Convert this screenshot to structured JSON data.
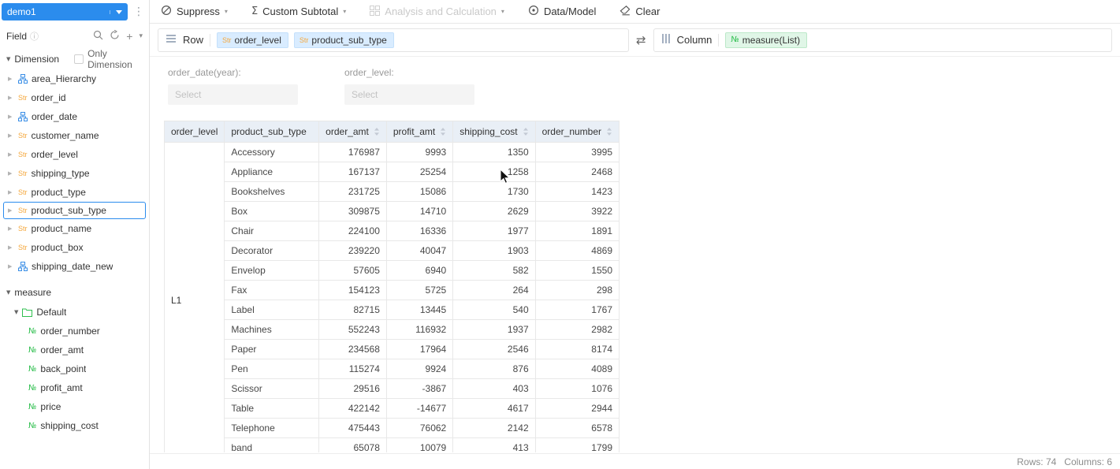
{
  "sidebar": {
    "dataset_label": "demo1",
    "field_label": "Field",
    "dimension": {
      "section_label": "Dimension",
      "only_dimension_label": "Only Dimension",
      "items": [
        {
          "label": "area_Hierarchy",
          "icon": "hierarchy",
          "selected": false
        },
        {
          "label": "order_id",
          "icon": "str",
          "selected": false
        },
        {
          "label": "order_date",
          "icon": "hierarchy",
          "selected": false
        },
        {
          "label": "customer_name",
          "icon": "str",
          "selected": false
        },
        {
          "label": "order_level",
          "icon": "str",
          "selected": false
        },
        {
          "label": "shipping_type",
          "icon": "str",
          "selected": false
        },
        {
          "label": "product_type",
          "icon": "str",
          "selected": false
        },
        {
          "label": "product_sub_type",
          "icon": "str",
          "selected": true
        },
        {
          "label": "product_name",
          "icon": "str",
          "selected": false
        },
        {
          "label": "product_box",
          "icon": "str",
          "selected": false
        },
        {
          "label": "shipping_date_new",
          "icon": "hierarchy",
          "selected": false
        }
      ]
    },
    "measure": {
      "section_label": "measure",
      "folder_label": "Default",
      "items": [
        {
          "label": "order_number",
          "icon": "num"
        },
        {
          "label": "order_amt",
          "icon": "num"
        },
        {
          "label": "back_point",
          "icon": "num"
        },
        {
          "label": "profit_amt",
          "icon": "num"
        },
        {
          "label": "price",
          "icon": "num"
        },
        {
          "label": "shipping_cost",
          "icon": "num"
        }
      ]
    }
  },
  "toolbar": {
    "suppress_label": "Suppress",
    "custom_subtotal_label": "Custom Subtotal",
    "analysis_label": "Analysis and Calculation",
    "data_model_label": "Data/Model",
    "clear_label": "Clear"
  },
  "shelf": {
    "row_label": "Row",
    "row_chips": [
      {
        "prefix": "Str",
        "label": "order_level"
      },
      {
        "prefix": "Str",
        "label": "product_sub_type"
      }
    ],
    "column_label": "Column",
    "column_chips": [
      {
        "prefix": "№",
        "label": "measure(List)"
      }
    ]
  },
  "filters": [
    {
      "label": "order_date(year):",
      "placeholder": "Select"
    },
    {
      "label": "order_level:",
      "placeholder": "Select"
    }
  ],
  "table": {
    "group_label": "L1",
    "columns": [
      {
        "label": "order_level",
        "sortable": false
      },
      {
        "label": "product_sub_type",
        "sortable": false
      },
      {
        "label": "order_amt",
        "sortable": true
      },
      {
        "label": "profit_amt",
        "sortable": true
      },
      {
        "label": "shipping_cost",
        "sortable": true
      },
      {
        "label": "order_number",
        "sortable": true
      }
    ],
    "rows": [
      {
        "name": "Accessory",
        "values": [
          "176987",
          "9993",
          "1350",
          "3995"
        ]
      },
      {
        "name": "Appliance",
        "values": [
          "167137",
          "25254",
          "1258",
          "2468"
        ]
      },
      {
        "name": "Bookshelves",
        "values": [
          "231725",
          "15086",
          "1730",
          "1423"
        ]
      },
      {
        "name": "Box",
        "values": [
          "309875",
          "14710",
          "2629",
          "3922"
        ]
      },
      {
        "name": "Chair",
        "values": [
          "224100",
          "16336",
          "1977",
          "1891"
        ]
      },
      {
        "name": "Decorator",
        "values": [
          "239220",
          "40047",
          "1903",
          "4869"
        ]
      },
      {
        "name": "Envelop",
        "values": [
          "57605",
          "6940",
          "582",
          "1550"
        ]
      },
      {
        "name": "Fax",
        "values": [
          "154123",
          "5725",
          "264",
          "298"
        ]
      },
      {
        "name": "Label",
        "values": [
          "82715",
          "13445",
          "540",
          "1767"
        ]
      },
      {
        "name": "Machines",
        "values": [
          "552243",
          "116932",
          "1937",
          "2982"
        ]
      },
      {
        "name": "Paper",
        "values": [
          "234568",
          "17964",
          "2546",
          "8174"
        ]
      },
      {
        "name": "Pen",
        "values": [
          "115274",
          "9924",
          "876",
          "4089"
        ]
      },
      {
        "name": "Scissor",
        "values": [
          "29516",
          "-3867",
          "403",
          "1076"
        ]
      },
      {
        "name": "Table",
        "values": [
          "422142",
          "-14677",
          "4617",
          "2944"
        ]
      },
      {
        "name": "Telephone",
        "values": [
          "475443",
          "76062",
          "2142",
          "6578"
        ]
      },
      {
        "name": "band",
        "values": [
          "65078",
          "10079",
          "413",
          "1799"
        ]
      }
    ]
  },
  "status": {
    "rows": "Rows: 74",
    "columns": "Columns: 6"
  }
}
